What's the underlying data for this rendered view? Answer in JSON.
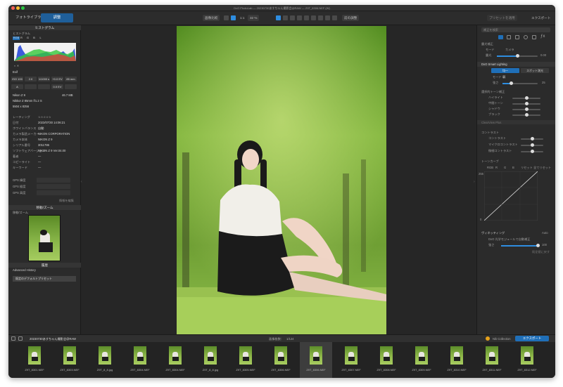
{
  "window": {
    "title": "DxO PhotoLab — 20230730あすちゃん撮影会@RAW — Z9T_8306.NEF (W)"
  },
  "toolbar": {
    "tab_library": "フォトライブラリ",
    "tab_customize": "調整",
    "compare_label": "画像比較",
    "zoom_label": "1:1",
    "zoom_pct": "32 %",
    "before_after": "前の調整",
    "apply_preset": "プリセットを適用",
    "export_label": "エクスポート"
  },
  "left": {
    "histogram_header": "ヒストグラム",
    "histogram_title": "ヒストグラム",
    "channels": [
      "RGB",
      "R",
      "G",
      "B",
      "L"
    ],
    "exif_label": "Exif",
    "exif_values": [
      "ISO 100",
      "2.0",
      "1/1000 s",
      "+0.0 EV",
      "85 mm"
    ],
    "exif_row2": [
      "A",
      "",
      "",
      "0.0 EV",
      ""
    ],
    "camera": "Nikon Z 9",
    "camera_size": "46.7 MB",
    "lens": "Nikkor Z 85mm f/1.2 S",
    "dimensions": "5504 x 8256",
    "meta": [
      {
        "k": "レーティング",
        "v": "☆☆☆☆☆"
      },
      {
        "k": "日付",
        "v": "2023/07/30 14:06:21"
      },
      {
        "k": "ホワイトバランス",
        "v": "自動"
      },
      {
        "k": "カメラ製造メーカー",
        "v": "NIKON CORPORATION"
      },
      {
        "k": "カメラ本体",
        "v": "NIKON Z 9"
      },
      {
        "k": "シリアル番号",
        "v": "3011786"
      },
      {
        "k": "ソフトウェアバージョン",
        "v": "NIKON Z 9 Ver.04.00"
      },
      {
        "k": "著者",
        "v": "—"
      },
      {
        "k": "コピーライト",
        "v": "—"
      },
      {
        "k": "キーワード",
        "v": "—"
      }
    ],
    "gps": [
      {
        "k": "GPS 緯度"
      },
      {
        "k": "GPS 経度"
      },
      {
        "k": "GPS 高度"
      }
    ],
    "meta_link": "情報を編集",
    "loupe_header": "移動/ズーム",
    "loupe_title": "移動/ズーム",
    "history_header": "履歴",
    "advanced_history": "Advanced History",
    "history_item": "既定のデフォルトプリセット"
  },
  "right": {
    "search_placeholder": "補正を検索",
    "group1": "露光補正",
    "mode_label": "モード",
    "mode_value": "カメラ",
    "exposure_label": "露光",
    "exposure_val": "0.00",
    "smart_lighting": "DxO Smart Lighting",
    "sl_mode_a": "均一",
    "sl_mode_b": "スポット測光",
    "sl_mode_label": "モード",
    "sl_mode_value": "弱",
    "sl_strength": "強さ",
    "sl_strength_val": "25",
    "tone_group": "選択的トーン補正",
    "tone_items": [
      "ハイライト",
      "中間トーン",
      "シャドウ",
      "ブラック"
    ],
    "contrast_group": "コントラスト",
    "contrast_items": [
      "コントラスト",
      "マイクロコントラスト",
      "微細コントラスト"
    ],
    "clearview": "ClearView Plus",
    "tone_curve": "トーンカーブ",
    "curve_modes": [
      "RGB",
      "R",
      "G",
      "B",
      "リセット",
      "全てリセット"
    ],
    "curve_in": "255",
    "curve_out": "0",
    "vignetting": "ヴィネッティング",
    "vig_mode": "Auto",
    "vig_a": "DxO 光学モジュールで自動補正",
    "vig_strength": "強さ",
    "vig_val": "100",
    "preset_link": "既定値に戻す"
  },
  "filmbar": {
    "folder": "20230730あすちゃん撮影会@RAW",
    "count_label": "画像枚数：",
    "count_value": "1/124",
    "nik": "Nik Collection",
    "export": "エクスポート"
  },
  "thumbs": [
    "Z9T_8301.NEF",
    "Z9T_8303.NEF",
    "Z9T_8_8.jpg",
    "Z9T_8304.NEF",
    "Z9T_8304.NEF",
    "Z9T_8_8.jpg",
    "Z9T_8305.NEF",
    "Z9T_8306.NEF",
    "Z9T_8306.NEF",
    "Z9T_8307.NEF",
    "Z9T_8308.NEF",
    "Z9T_8309.NEF",
    "Z9T_8310.NEF",
    "Z9T_8311.NEF",
    "Z9T_8312.NEF"
  ],
  "colors": {
    "accent": "#1f6fb8",
    "bg": "#262626",
    "panel": "#2b2b2b"
  }
}
